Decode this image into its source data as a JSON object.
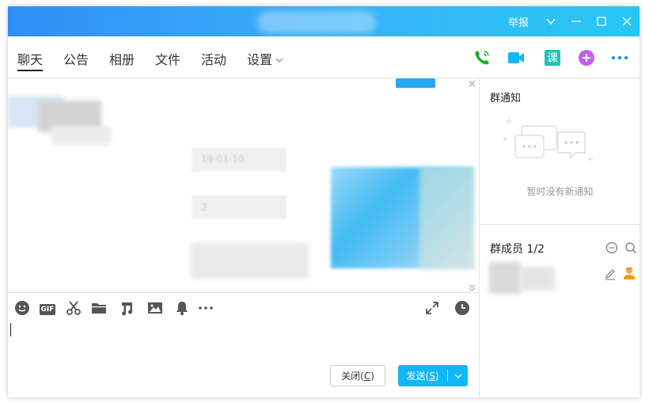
{
  "window": {
    "title": "",
    "report_label": "举报",
    "controls": [
      "dropdown",
      "minimize",
      "maximize",
      "close"
    ]
  },
  "tabs": [
    {
      "label": "聊天",
      "active": true
    },
    {
      "label": "公告",
      "active": false
    },
    {
      "label": "相册",
      "active": false
    },
    {
      "label": "文件",
      "active": false
    },
    {
      "label": "活动",
      "active": false
    },
    {
      "label": "设置",
      "active": false,
      "has_dropdown": true
    }
  ],
  "tab_actions": [
    {
      "icon": "phone-call-icon",
      "color": "#1aad19"
    },
    {
      "icon": "video-call-icon",
      "color": "#12b7f5"
    },
    {
      "icon": "course-icon",
      "label": "课",
      "color": "#1dc4b3"
    },
    {
      "icon": "add-app-icon",
      "color": "#c55df0"
    },
    {
      "icon": "more-icon",
      "color": "#1f8ff5"
    }
  ],
  "chat": {
    "messages": [
      {
        "text": "19-01-10",
        "blurred": true
      },
      {
        "text": "2",
        "blurred": true
      }
    ]
  },
  "input_toolbar": {
    "tools": [
      "emoji-icon",
      "gif-icon",
      "screenshot-scissors-icon",
      "folder-icon",
      "music-icon",
      "image-icon",
      "bell-icon",
      "more-tools-icon"
    ],
    "gif_label": "GIF",
    "right_tools": [
      "expand-icon",
      "history-clock-icon"
    ]
  },
  "input": {
    "value": ""
  },
  "buttons": {
    "close_label": "关闭",
    "close_hotkey": "C",
    "send_label": "发送",
    "send_hotkey": "S"
  },
  "right_panel": {
    "notice_title": "群通知",
    "notice_empty": "暂时没有新通知",
    "members_title": "群成员 1/2"
  },
  "colors": {
    "titlebar_start": "#2f8ff7",
    "titlebar_end": "#27c7f3",
    "send_button": "#12b7f5"
  }
}
